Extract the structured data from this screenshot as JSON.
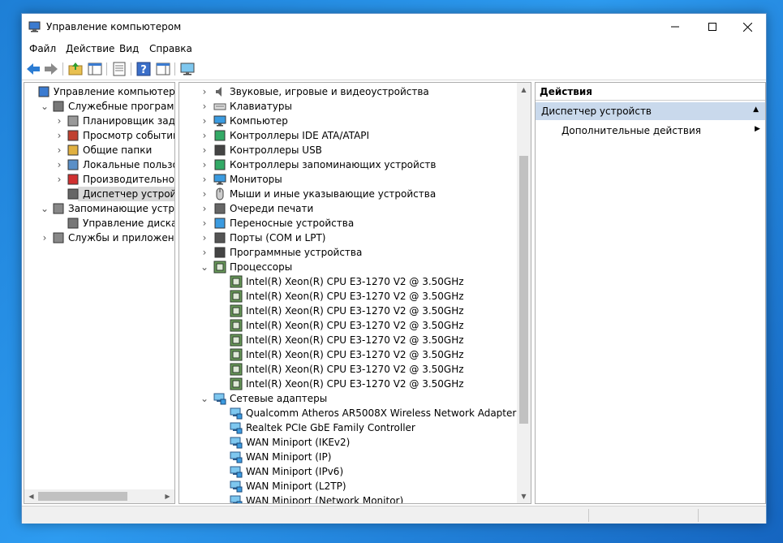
{
  "window": {
    "title": "Управление компьютером"
  },
  "menu": [
    "Файл",
    "Действие",
    "Вид",
    "Справка"
  ],
  "toolbar": {
    "icons": [
      "back-arrow-icon",
      "forward-arrow-icon",
      "up-folder-icon",
      "show-tree-icon",
      "properties-icon",
      "help-icon",
      "view-icon",
      "monitor-icon"
    ]
  },
  "left_tree": [
    {
      "label": "Управление компьютером (л",
      "level": 0,
      "expander": "",
      "icon": "computer-management-icon"
    },
    {
      "label": "Служебные программы",
      "level": 1,
      "expander": "v",
      "icon": "tools-icon"
    },
    {
      "label": "Планировщик заданий",
      "level": 2,
      "expander": ">",
      "icon": "clock-icon"
    },
    {
      "label": "Просмотр событий",
      "level": 2,
      "expander": ">",
      "icon": "event-viewer-icon"
    },
    {
      "label": "Общие папки",
      "level": 2,
      "expander": ">",
      "icon": "shared-folders-icon"
    },
    {
      "label": "Локальные пользовате",
      "level": 2,
      "expander": ">",
      "icon": "users-icon"
    },
    {
      "label": "Производительность",
      "level": 2,
      "expander": ">",
      "icon": "performance-icon"
    },
    {
      "label": "Диспетчер устройств",
      "level": 2,
      "expander": "",
      "icon": "device-manager-icon",
      "selected": true
    },
    {
      "label": "Запоминающие устройст",
      "level": 1,
      "expander": "v",
      "icon": "storage-icon"
    },
    {
      "label": "Управление дисками",
      "level": 2,
      "expander": "",
      "icon": "disk-management-icon"
    },
    {
      "label": "Службы и приложения",
      "level": 1,
      "expander": ">",
      "icon": "services-icon"
    }
  ],
  "device_tree": [
    {
      "label": "Звуковые, игровые и видеоустройства",
      "child": false,
      "expanded": false,
      "icon": "speaker-icon"
    },
    {
      "label": "Клавиатуры",
      "child": false,
      "expanded": false,
      "icon": "keyboard-icon"
    },
    {
      "label": "Компьютер",
      "child": false,
      "expanded": false,
      "icon": "computer-icon"
    },
    {
      "label": "Контроллеры IDE ATA/ATAPI",
      "child": false,
      "expanded": false,
      "icon": "ide-controller-icon"
    },
    {
      "label": "Контроллеры USB",
      "child": false,
      "expanded": false,
      "icon": "usb-icon"
    },
    {
      "label": "Контроллеры запоминающих устройств",
      "child": false,
      "expanded": false,
      "icon": "storage-controller-icon"
    },
    {
      "label": "Мониторы",
      "child": false,
      "expanded": false,
      "icon": "monitor-icon"
    },
    {
      "label": "Мыши и иные указывающие устройства",
      "child": false,
      "expanded": false,
      "icon": "mouse-icon"
    },
    {
      "label": "Очереди печати",
      "child": false,
      "expanded": false,
      "icon": "printer-icon"
    },
    {
      "label": "Переносные устройства",
      "child": false,
      "expanded": false,
      "icon": "portable-device-icon"
    },
    {
      "label": "Порты (COM и LPT)",
      "child": false,
      "expanded": false,
      "icon": "port-icon"
    },
    {
      "label": "Программные устройства",
      "child": false,
      "expanded": false,
      "icon": "software-device-icon"
    },
    {
      "label": "Процессоры",
      "child": false,
      "expanded": true,
      "icon": "processor-icon"
    },
    {
      "label": "Intel(R) Xeon(R) CPU E3-1270 V2 @ 3.50GHz",
      "child": true,
      "icon": "processor-icon"
    },
    {
      "label": "Intel(R) Xeon(R) CPU E3-1270 V2 @ 3.50GHz",
      "child": true,
      "icon": "processor-icon"
    },
    {
      "label": "Intel(R) Xeon(R) CPU E3-1270 V2 @ 3.50GHz",
      "child": true,
      "icon": "processor-icon"
    },
    {
      "label": "Intel(R) Xeon(R) CPU E3-1270 V2 @ 3.50GHz",
      "child": true,
      "icon": "processor-icon"
    },
    {
      "label": "Intel(R) Xeon(R) CPU E3-1270 V2 @ 3.50GHz",
      "child": true,
      "icon": "processor-icon"
    },
    {
      "label": "Intel(R) Xeon(R) CPU E3-1270 V2 @ 3.50GHz",
      "child": true,
      "icon": "processor-icon"
    },
    {
      "label": "Intel(R) Xeon(R) CPU E3-1270 V2 @ 3.50GHz",
      "child": true,
      "icon": "processor-icon"
    },
    {
      "label": "Intel(R) Xeon(R) CPU E3-1270 V2 @ 3.50GHz",
      "child": true,
      "icon": "processor-icon"
    },
    {
      "label": "Сетевые адаптеры",
      "child": false,
      "expanded": true,
      "icon": "network-adapter-icon"
    },
    {
      "label": "Qualcomm Atheros AR5008X Wireless Network Adapter",
      "child": true,
      "icon": "network-adapter-icon"
    },
    {
      "label": "Realtek PCIe GbE Family Controller",
      "child": true,
      "icon": "network-adapter-icon"
    },
    {
      "label": "WAN Miniport (IKEv2)",
      "child": true,
      "icon": "network-adapter-icon"
    },
    {
      "label": "WAN Miniport (IP)",
      "child": true,
      "icon": "network-adapter-icon"
    },
    {
      "label": "WAN Miniport (IPv6)",
      "child": true,
      "icon": "network-adapter-icon"
    },
    {
      "label": "WAN Miniport (L2TP)",
      "child": true,
      "icon": "network-adapter-icon"
    },
    {
      "label": "WAN Miniport (Network Monitor)",
      "child": true,
      "icon": "network-adapter-icon"
    }
  ],
  "actions": {
    "header": "Действия",
    "section": "Диспетчер устройств",
    "item": "Дополнительные действия"
  }
}
